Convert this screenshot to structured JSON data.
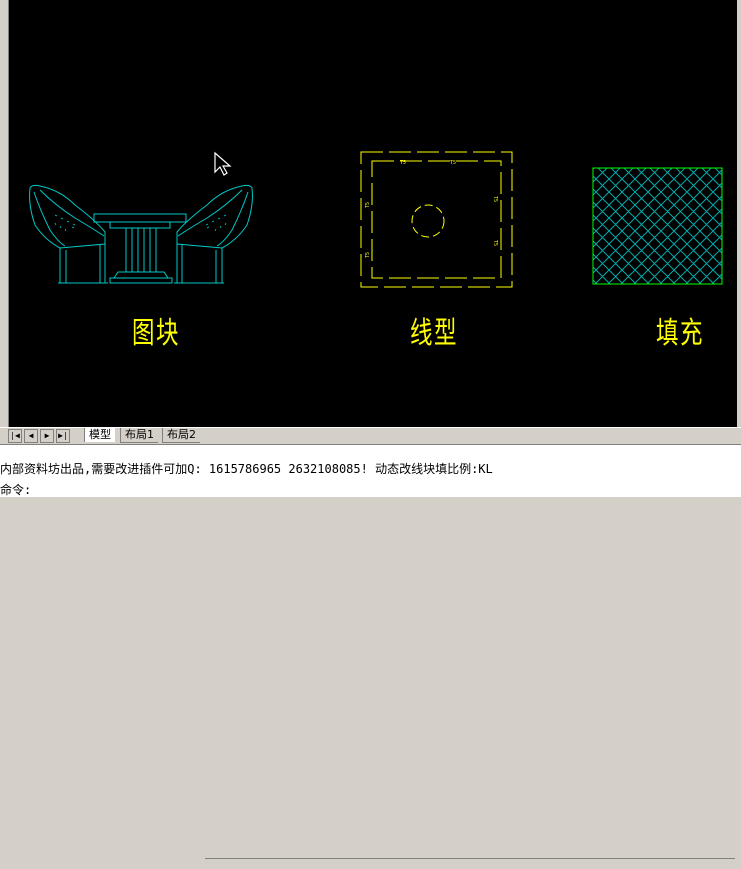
{
  "blocks": {
    "block_label": "图块",
    "linetype_label": "线型",
    "hatch_label": "填充",
    "linetype_codes": [
      "T5",
      "T5",
      "T5",
      "T5",
      "T5",
      "T5"
    ]
  },
  "tabs": {
    "nav_first": "|◀",
    "nav_prev": "◀",
    "nav_next": "▶",
    "nav_last": "▶|",
    "model": "模型",
    "layout1": "布局1",
    "layout2": "布局2"
  },
  "command": {
    "history_line": "内部资料坊出品,需要改进插件可加Q: 1615786965 2632108085! 动态改线块填比例:KL",
    "prompt": "命令:"
  },
  "colors": {
    "background": "#000000",
    "block_cyan": "#00c8c8",
    "linetype_yellow": "#ffff00",
    "hatch_green": "#00ff00",
    "hatch_pattern": "#00aaaa"
  }
}
